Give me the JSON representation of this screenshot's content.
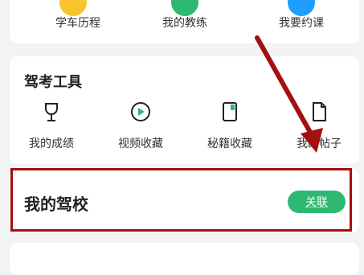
{
  "top_menu": [
    {
      "label": "学车历程",
      "icon": "history-icon",
      "color": "#f5b81b"
    },
    {
      "label": "我的教练",
      "icon": "coach-icon",
      "color": "#2eb872"
    },
    {
      "label": "我要约课",
      "icon": "booking-icon",
      "color": "#1e9fff"
    }
  ],
  "tools": {
    "title": "驾考工具",
    "items": [
      {
        "label": "我的成绩",
        "icon": "trophy-icon"
      },
      {
        "label": "视频收藏",
        "icon": "video-play-icon"
      },
      {
        "label": "秘籍收藏",
        "icon": "book-icon"
      },
      {
        "label": "我的帖子",
        "icon": "document-icon"
      }
    ]
  },
  "school": {
    "title": "我的驾校",
    "link_label": "关联"
  },
  "colors": {
    "accent": "#2eb872",
    "annotation": "#a40f10"
  }
}
